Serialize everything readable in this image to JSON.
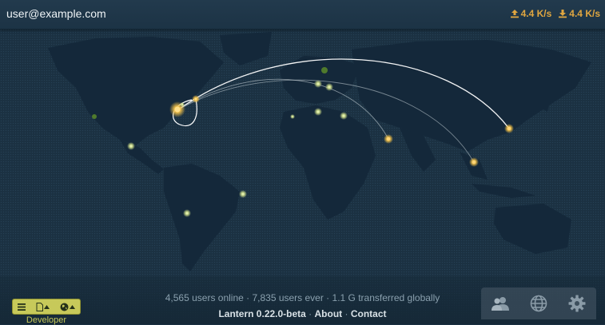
{
  "header": {
    "user_email": "user@example.com",
    "upload_rate": "4.4 K/s",
    "download_rate": "4.4 K/s"
  },
  "footer": {
    "stats_line": "4,565 users online · 7,835 users ever · 1.1 G transferred globally",
    "version_label": "Lantern 0.22.0-beta",
    "about_label": "About",
    "contact_label": "Contact",
    "separator": " · ",
    "developer_label": "Developer"
  },
  "developer_tools": [
    "menu-icon",
    "file-icon",
    "globe-icon"
  ],
  "right_panel_icons": [
    "users-icon",
    "globe-icon",
    "gear-icon"
  ],
  "colors": {
    "background": "#1b3142",
    "land": "#15293a",
    "accent_rate": "#e0a640",
    "developer_box": "#c7c95a",
    "arc": "#ffffff"
  }
}
